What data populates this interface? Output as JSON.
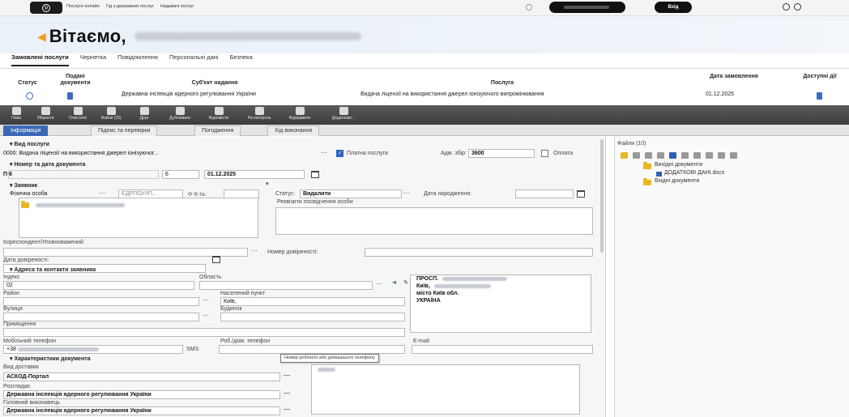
{
  "portal": {
    "links": [
      "Послуги онлайн",
      "Гід з державних послуг",
      "Надавачі послуг"
    ],
    "login_label": "Вхід",
    "greeting": "Вітаємо,"
  },
  "main_tabs": [
    "Замовлені послуги",
    "Чернетка",
    "Повідомлення",
    "Персональні дані",
    "Безпека"
  ],
  "services_table": {
    "headers": {
      "status": "Статус",
      "docs": "Подані документи",
      "subject": "Суб'єкт надання",
      "service": "Послуга",
      "date": "Дата замовлення",
      "actions": "Доступні дії"
    },
    "row": {
      "subject": "Державна інспекція ядерного регулювання України",
      "service": "Видача ліцензії на використання джерел іонізуючого випромінювання",
      "date": "01.12.2025"
    }
  },
  "toolbar": [
    "Нова",
    "Зберегти",
    "Очистити",
    "Файли (10)",
    "Друк",
    "Дублювати",
    "Відповісти",
    "На контроль",
    "Відправити",
    "Додатково..."
  ],
  "sub_tabs": [
    "Інформація",
    "Підпис та перевірки",
    "Погодження",
    "Хід виконання"
  ],
  "form": {
    "service_section": "Вид послуги",
    "service_value": "0000: Видача ліцензії на використання джерел іонізуючог...",
    "paid_label": "Платна послуга",
    "adm_fee_label": "Адм. збір:",
    "adm_fee_value": "3600",
    "payment_label": "Оплата",
    "doc_number_section": "Номер та дата документа",
    "doc_prefix": "П 6",
    "doc_number": "6",
    "doc_date": "01.12.2025",
    "applicant_section": "Заявник",
    "applicant_type": "Фізична особа",
    "edrpou_placeholder": "ЄДРПОУ/ІП...",
    "count_placeholder": "К-ть:",
    "status_label": "Статус:",
    "status_value": "Видалити",
    "birth_label": "Дата народження:",
    "id_doc_label": "Реквізити посвідчення особи",
    "correspondent_label": "Кореспондент/Уповноважений",
    "proxy_number_label": "Номер довіреності:",
    "proxy_date_label": "Дата довіреності:",
    "address_section": "Адреса та контакти заявника",
    "index_label": "Індекс",
    "index_value": "02",
    "region_label": "Область",
    "district_label": "Район",
    "settlement_label": "Населений пункт",
    "settlement_value": "Київ,",
    "street_label": "Вулиця",
    "building_label": "Будинок",
    "room_label": "Приміщення",
    "mobile_label": "Мобільний телефон",
    "mobile_value": "+38",
    "sms_label": "SMS",
    "work_phone_label": "Роб./дом. телефон",
    "email_label": "E-mail",
    "address_box": [
      "ПРОСП.",
      "Київ,",
      "місто Київ обл.",
      "",
      "УКРАЇНА"
    ],
    "tooltip": "Номер робочого або домашнього телефону",
    "doc_chars_section": "Характеристики документа",
    "delivery_label": "Вид доставки",
    "delivery_value": "АСКОД-Портал",
    "reviewer_label": "Розглядає",
    "reviewer_value": "Державна інспекція ядерного регулювання України",
    "executor_label": "Головний виконавець",
    "executor_value": "Державна інспекція ядерного регулювання України"
  },
  "files": {
    "title": "Файли (10)",
    "tree": [
      "Вихідні документи",
      "ДОДАТКОВІ ДАНІ.docx",
      "Вхідні документи"
    ]
  },
  "colors": {
    "accent": "#3b69b6",
    "toolbar": "#4a4a4a",
    "folder": "#e8b826"
  }
}
